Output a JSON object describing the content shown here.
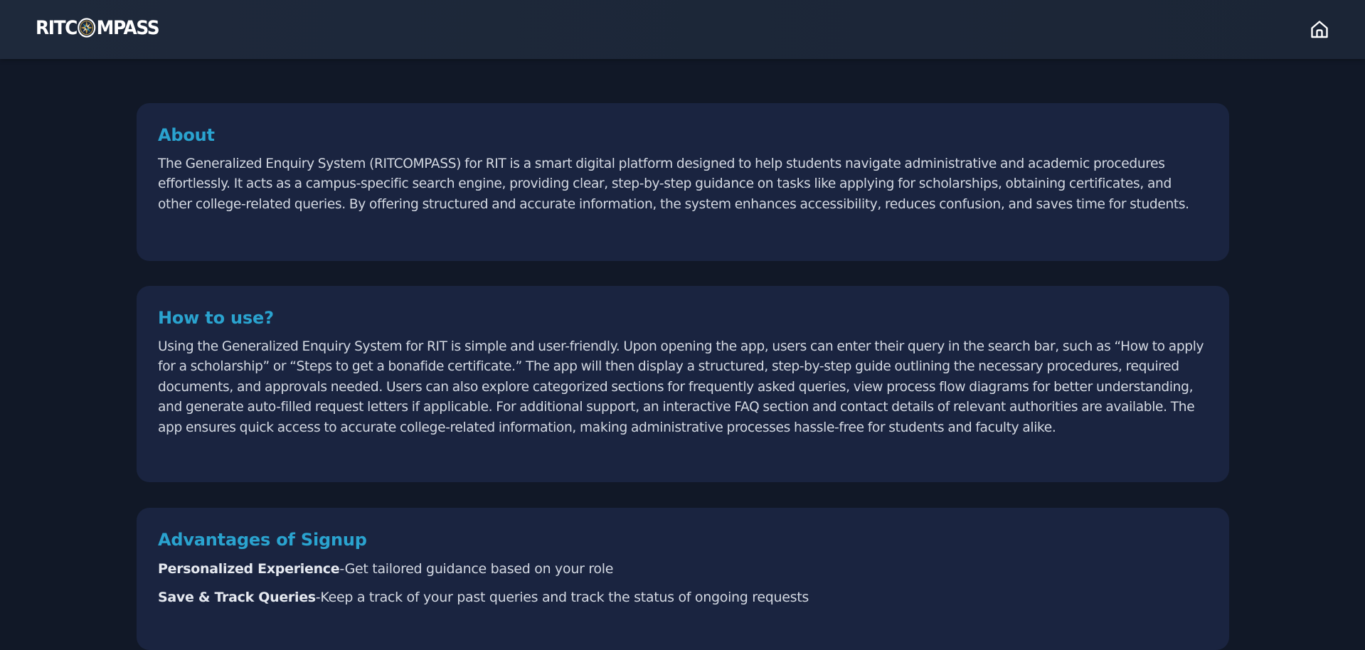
{
  "header": {
    "logo_text_left": "RITC",
    "logo_text_right": "MPASS",
    "home_icon": "home-icon"
  },
  "about": {
    "title": "About",
    "body": "The Generalized Enquiry System (RITCOMPASS) for RIT is a smart digital platform designed to help students navigate administrative and academic procedures effortlessly. It acts as a campus-specific search engine, providing clear, step-by-step guidance on tasks like applying for scholarships, obtaining certificates, and other college-related queries. By offering structured and accurate information, the system enhances accessibility, reduces confusion, and saves time for students."
  },
  "howto": {
    "title": "How to use?",
    "body": "Using the Generalized Enquiry System for RIT is simple and user-friendly. Upon opening the app, users can enter their query in the search bar, such as “How to apply for a scholarship” or “Steps to get a bonafide certificate.” The app will then display a structured, step-by-step guide outlining the necessary procedures, required documents, and approvals needed. Users can also explore categorized sections for frequently asked queries, view process flow diagrams for better understanding, and generate auto-filled request letters if applicable. For additional support, an interactive FAQ section and contact details of relevant authorities are available. The app ensures quick access to accurate college-related information, making administrative processes hassle-free for students and faculty alike."
  },
  "advantages": {
    "title": "Advantages of Signup",
    "items": [
      {
        "label": "Personalized Experience",
        "text": "-Get tailored guidance based on your role"
      },
      {
        "label": "Save & Track Queries",
        "text": "-Keep a track of your past queries and track the status of ongoing requests"
      }
    ]
  },
  "colors": {
    "page_bg": "#111827",
    "header_bg": "#1e293b",
    "card_bg": "#1a2440",
    "heading_accent": "#2aa3cf",
    "body_text": "#d4d9e2"
  }
}
